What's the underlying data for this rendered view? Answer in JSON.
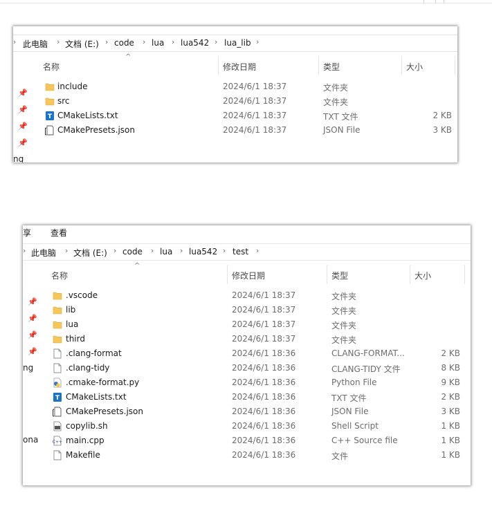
{
  "window1": {
    "breadcrumb": [
      "此电脑",
      "文档 (E:)",
      "code",
      "lua",
      "lua542",
      "lua_lib"
    ],
    "columns": {
      "name": "名称",
      "date": "修改日期",
      "type": "类型",
      "size": "大小"
    },
    "left_fragment": "ng",
    "files": [
      {
        "name": "include",
        "date": "2024/6/1 18:37",
        "type": "文件夹",
        "size": "",
        "icon": "folder-icon"
      },
      {
        "name": "src",
        "date": "2024/6/1 18:37",
        "type": "文件夹",
        "size": "",
        "icon": "folder-icon"
      },
      {
        "name": "CMakeLists.txt",
        "date": "2024/6/1 18:37",
        "type": "TXT 文件",
        "size": "2 KB",
        "icon": "txt-file-icon"
      },
      {
        "name": "CMakePresets.json",
        "date": "2024/6/1 18:37",
        "type": "JSON File",
        "size": "3 KB",
        "icon": "json-file-icon"
      }
    ]
  },
  "window2": {
    "menu": {
      "share": "享",
      "view": "查看"
    },
    "breadcrumb": [
      "此电脑",
      "文档 (E:)",
      "code",
      "lua",
      "lua542",
      "test"
    ],
    "columns": {
      "name": "名称",
      "date": "修改日期",
      "type": "类型",
      "size": "大小"
    },
    "left_fragment_1": "ng",
    "left_fragment_2": "ona",
    "files": [
      {
        "name": ".vscode",
        "date": "2024/6/1 18:37",
        "type": "文件夹",
        "size": "",
        "icon": "folder-icon"
      },
      {
        "name": "lib",
        "date": "2024/6/1 18:37",
        "type": "文件夹",
        "size": "",
        "icon": "folder-icon"
      },
      {
        "name": "lua",
        "date": "2024/6/1 18:37",
        "type": "文件夹",
        "size": "",
        "icon": "folder-icon"
      },
      {
        "name": "third",
        "date": "2024/6/1 18:37",
        "type": "文件夹",
        "size": "",
        "icon": "folder-icon"
      },
      {
        "name": ".clang-format",
        "date": "2024/6/1 18:36",
        "type": "CLANG-FORMAT...",
        "size": "2 KB",
        "icon": "blank-file-icon"
      },
      {
        "name": ".clang-tidy",
        "date": "2024/6/1 18:36",
        "type": "CLANG-TIDY 文件",
        "size": "8 KB",
        "icon": "blank-file-icon"
      },
      {
        "name": ".cmake-format.py",
        "date": "2024/6/1 18:36",
        "type": "Python File",
        "size": "9 KB",
        "icon": "python-file-icon"
      },
      {
        "name": "CMakeLists.txt",
        "date": "2024/6/1 18:36",
        "type": "TXT 文件",
        "size": "2 KB",
        "icon": "txt-file-icon"
      },
      {
        "name": "CMakePresets.json",
        "date": "2024/6/1 18:36",
        "type": "JSON File",
        "size": "3 KB",
        "icon": "json-file-icon"
      },
      {
        "name": "copylib.sh",
        "date": "2024/6/1 18:36",
        "type": "Shell Script",
        "size": "1 KB",
        "icon": "shell-file-icon"
      },
      {
        "name": "main.cpp",
        "date": "2024/6/1 18:36",
        "type": "C++ Source file",
        "size": "1 KB",
        "icon": "cpp-file-icon"
      },
      {
        "name": "Makefile",
        "date": "2024/6/1 18:36",
        "type": "文件",
        "size": "1 KB",
        "icon": "blank-file-icon"
      }
    ]
  },
  "colors": {
    "folder": "#f5c65a",
    "folder_edge": "#e1a93a",
    "txt_icon": "#1a73c9",
    "accent_text": "#6d6d6d"
  }
}
